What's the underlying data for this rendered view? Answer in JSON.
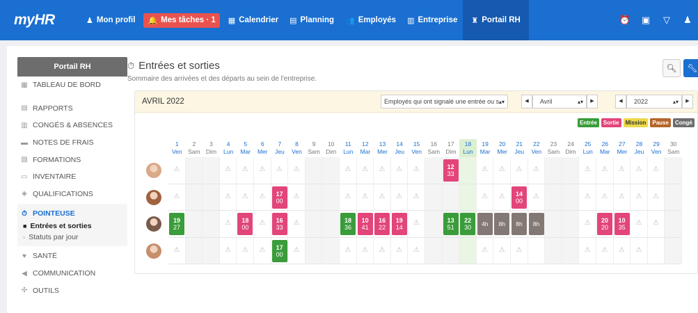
{
  "app": {
    "logo": "myHR"
  },
  "nav": [
    {
      "label": "Mon profil",
      "icon": "user-icon",
      "glyph": "♟"
    },
    {
      "label": "Mes tâches · 1",
      "icon": "bell-icon",
      "glyph": "🔔",
      "badge": true
    },
    {
      "label": "Calendrier",
      "icon": "calendar-icon",
      "glyph": "▦"
    },
    {
      "label": "Planning",
      "icon": "planning-icon",
      "glyph": "▤"
    },
    {
      "label": "Employés",
      "icon": "users-icon",
      "glyph": "👥"
    },
    {
      "label": "Entreprise",
      "icon": "building-icon",
      "glyph": "▥"
    },
    {
      "label": "Portail RH",
      "icon": "hr-portal-icon",
      "glyph": "♜",
      "active": true
    }
  ],
  "top_right": [
    "alarm-icon",
    "clipboard-icon",
    "filter-icon",
    "user-icon"
  ],
  "sidebar": {
    "header": "Portail RH",
    "items": [
      {
        "label": "TABLEAU DE BORD",
        "icon": "dashboard-icon"
      },
      {
        "label": "RAPPORTS",
        "icon": "report-icon"
      },
      {
        "label": "CONGÉS & ABSENCES",
        "icon": "leave-icon"
      },
      {
        "label": "NOTES DE FRAIS",
        "icon": "expenses-icon"
      },
      {
        "label": "FORMATIONS",
        "icon": "training-icon"
      },
      {
        "label": "INVENTAIRE",
        "icon": "inventory-icon"
      },
      {
        "label": "QUALIFICATIONS",
        "icon": "qualification-icon"
      }
    ],
    "group": {
      "label": "POINTEUSE",
      "icon": "clock-icon",
      "subitems": [
        {
          "label": "Entrées et sorties",
          "active": true
        },
        {
          "label": "Statuts par jour",
          "active": false
        }
      ]
    },
    "items_after": [
      {
        "label": "SANTÉ",
        "icon": "heart-icon"
      },
      {
        "label": "COMMUNICATION",
        "icon": "megaphone-icon"
      },
      {
        "label": "OUTILS",
        "icon": "tools-icon"
      }
    ]
  },
  "main": {
    "title": "Entrées et sorties",
    "subtitle": "Sommaire des arrivées et des départs au sein de l'entreprise."
  },
  "calendar": {
    "month_label": "AVRIL 2022",
    "filter_value": "Employés qui ont signalé une entrée ou s",
    "month_select": "Avril",
    "year_select": "2022",
    "legend": [
      {
        "label": "Entrée",
        "color": "#3a9c3a"
      },
      {
        "label": "Sortie",
        "color": "#e2457a"
      },
      {
        "label": "Mission",
        "color": "#ecd84a",
        "text_color": "#333"
      },
      {
        "label": "Pause",
        "color": "#b5652a"
      },
      {
        "label": "Congé",
        "color": "#6e6e6e"
      }
    ],
    "days": [
      [
        "1",
        "Ven"
      ],
      [
        "2",
        "Sam"
      ],
      [
        "3",
        "Dim"
      ],
      [
        "4",
        "Lun"
      ],
      [
        "5",
        "Mar"
      ],
      [
        "6",
        "Mer"
      ],
      [
        "7",
        "Jeu"
      ],
      [
        "8",
        "Ven"
      ],
      [
        "9",
        "Sam"
      ],
      [
        "10",
        "Dim"
      ],
      [
        "11",
        "Lun"
      ],
      [
        "12",
        "Mar"
      ],
      [
        "13",
        "Mer"
      ],
      [
        "14",
        "Jeu"
      ],
      [
        "15",
        "Ven"
      ],
      [
        "16",
        "Sam"
      ],
      [
        "17",
        "Dim"
      ],
      [
        "18",
        "Lun"
      ],
      [
        "19",
        "Mar"
      ],
      [
        "20",
        "Mer"
      ],
      [
        "21",
        "Jeu"
      ],
      [
        "22",
        "Ven"
      ],
      [
        "23",
        "Sam"
      ],
      [
        "24",
        "Dim"
      ],
      [
        "25",
        "Lun"
      ],
      [
        "26",
        "Mar"
      ],
      [
        "27",
        "Mer"
      ],
      [
        "28",
        "Jeu"
      ],
      [
        "29",
        "Ven"
      ],
      [
        "30",
        "Sam"
      ]
    ],
    "weekend_days": [
      2,
      3,
      9,
      10,
      16,
      17,
      23,
      24,
      30
    ],
    "today_day": 18,
    "rows": [
      {
        "avatar_color": "#d9a98a",
        "entries": {
          "1": "w",
          "4": "w",
          "5": "w",
          "6": "w",
          "7": "w",
          "8": "w",
          "11": "w",
          "12": "w",
          "13": "w",
          "14": "w",
          "15": "w",
          "17": {
            "t": "12",
            "b": "33",
            "k": "out"
          },
          "19": "w",
          "20": "w",
          "21": "w",
          "22": "w",
          "25": "w",
          "26": "w",
          "27": "w",
          "28": "w",
          "29": "w"
        }
      },
      {
        "avatar_color": "#a0633f",
        "entries": {
          "1": "w",
          "4": "w",
          "5": "w",
          "6": "w",
          "7": {
            "t": "17",
            "b": "00",
            "k": "out"
          },
          "8": "w",
          "11": "w",
          "12": "w",
          "13": "w",
          "14": "w",
          "15": "w",
          "19": "w",
          "20": "w",
          "21": {
            "t": "14",
            "b": "00",
            "k": "out"
          },
          "22": "w",
          "25": "w",
          "26": "w",
          "27": "w",
          "28": "w",
          "29": "w"
        }
      },
      {
        "avatar_color": "#7a5a4a",
        "entries": {
          "1": {
            "t": "19",
            "b": "27",
            "k": "in"
          },
          "4": "w",
          "5": {
            "t": "18",
            "b": "00",
            "k": "out"
          },
          "6": "w",
          "7": {
            "t": "16",
            "b": "33",
            "k": "out"
          },
          "8": "w",
          "11": {
            "t": "18",
            "b": "36",
            "k": "in"
          },
          "12": {
            "t": "10",
            "b": "41",
            "k": "out"
          },
          "13": {
            "t": "16",
            "b": "22",
            "k": "out"
          },
          "14": {
            "t": "19",
            "b": "14",
            "k": "out"
          },
          "15": "w",
          "17": {
            "t": "13",
            "b": "51",
            "k": "in"
          },
          "18": {
            "t": "22",
            "b": "30",
            "k": "in"
          },
          "19": {
            "h": "4h",
            "k": "leave"
          },
          "20": {
            "h": "8h",
            "k": "leave"
          },
          "21": {
            "h": "8h",
            "k": "leave"
          },
          "22": {
            "h": "8h",
            "k": "leave"
          },
          "25": "w",
          "26": {
            "t": "20",
            "b": "20",
            "k": "out"
          },
          "27": {
            "t": "10",
            "b": "35",
            "k": "out"
          },
          "28": "w",
          "29": "w"
        }
      },
      {
        "avatar_color": "#c68f6a",
        "entries": {
          "1": "w",
          "4": "w",
          "5": "w",
          "6": "w",
          "7": {
            "t": "17",
            "b": "00",
            "k": "in"
          },
          "8": "w",
          "11": "w",
          "12": "w",
          "13": "w",
          "14": "w",
          "15": "w",
          "19": "w",
          "20": "w",
          "21": "w",
          "25": "w",
          "26": "w",
          "27": "w",
          "28": "w"
        }
      }
    ],
    "kind_colors": {
      "in": "#3a9c3a",
      "out": "#e2457a",
      "leave": "#837873"
    }
  }
}
